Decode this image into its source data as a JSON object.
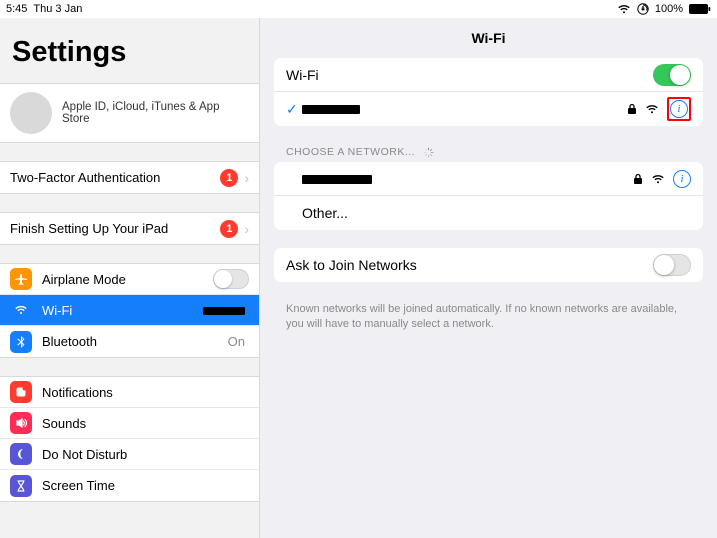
{
  "statusbar": {
    "time": "5:45",
    "date": "Thu 3 Jan",
    "battery": "100%"
  },
  "sidebar": {
    "title": "Settings",
    "appleid": "Apple ID, iCloud, iTunes & App Store",
    "twofa": "Two-Factor Authentication",
    "twofa_badge": "1",
    "finish": "Finish Setting Up Your iPad",
    "finish_badge": "1",
    "airplane": "Airplane Mode",
    "wifi": "Wi-Fi",
    "wifi_value": "",
    "bluetooth": "Bluetooth",
    "bluetooth_value": "On",
    "notifications": "Notifications",
    "sounds": "Sounds",
    "dnd": "Do Not Disturb",
    "screentime": "Screen Time"
  },
  "content": {
    "title": "Wi-Fi",
    "wifi_label": "Wi-Fi",
    "wifi_on": true,
    "choose": "CHOOSE A NETWORK...",
    "other": "Other...",
    "ask": "Ask to Join Networks",
    "ask_on": false,
    "ask_note": "Known networks will be joined automatically. If no known networks are available, you will have to manually select a network."
  }
}
